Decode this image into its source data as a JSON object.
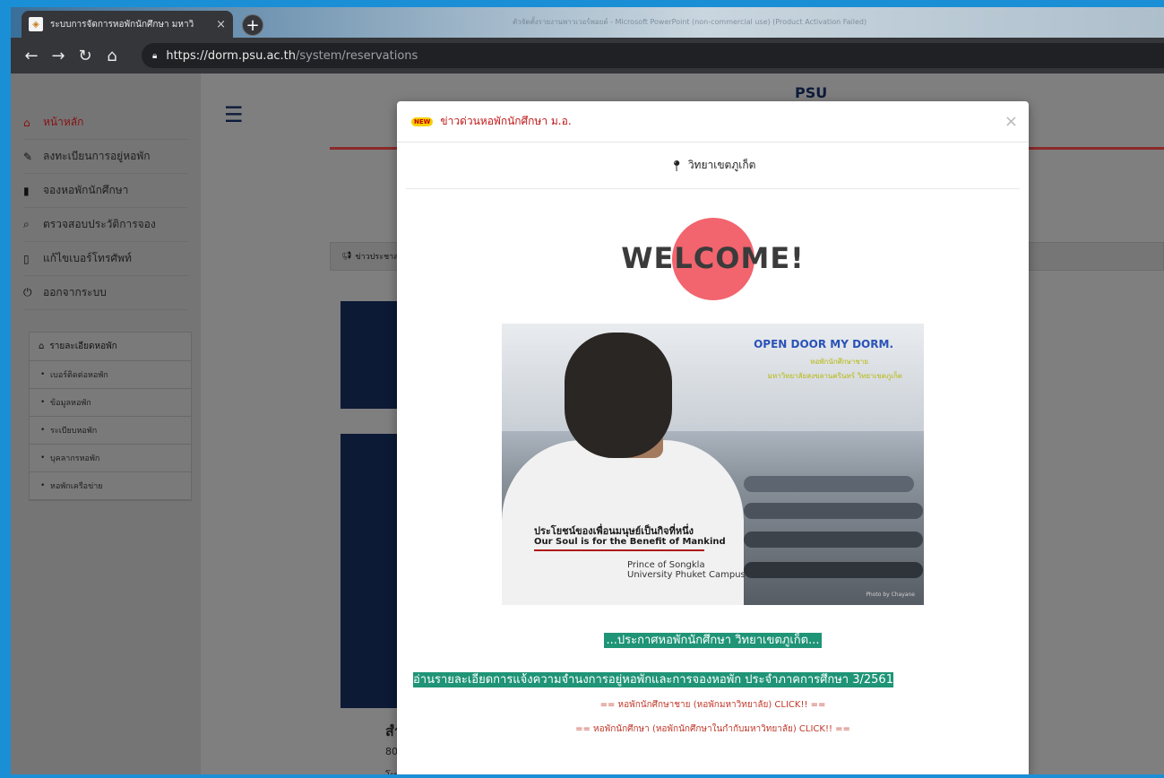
{
  "browser": {
    "tab_title": "ระบบการจัดการหอพักนักศึกษา มหาวิ",
    "tab_close": "×",
    "new_tab": "+",
    "window_title_blurred": "ตัวจัดตั้งรายงานพาวเวอร์พอยต์ - Microsoft PowerPoint (non-commercial use) (Product Activation Failed)",
    "url_host": "https://dorm.psu.ac.th",
    "url_path": "/system/reservations",
    "nav_icons": [
      "back-arrow-icon",
      "forward-arrow-icon",
      "reload-icon",
      "home-icon"
    ]
  },
  "sidebar": {
    "items": [
      {
        "label": "หน้าหลัก",
        "icon": "home-icon",
        "glyph": "🏠︎",
        "active": true
      },
      {
        "label": "ลงทะเบียนการอยู่หอพัก",
        "icon": "pencil-icon",
        "glyph": "✎",
        "active": false
      },
      {
        "label": "จองหอพักนักศึกษา",
        "icon": "book-icon",
        "glyph": "▮",
        "active": false
      },
      {
        "label": "ตรวจสอบประวัติการจอง",
        "icon": "search-icon",
        "glyph": "⌕",
        "active": false
      },
      {
        "label": "แก้ไขเบอร์โทรศัพท์",
        "icon": "phone-icon",
        "glyph": "▯",
        "active": false
      },
      {
        "label": "ออกจากระบบ",
        "icon": "power-icon",
        "glyph": "⏻",
        "active": false
      }
    ],
    "panel_title": "รายละเอียดหอพัก",
    "panel_items": [
      "เบอร์ติดต่อหอพัก",
      "ข้อมูลหอพัก",
      "ระเบียบหอพัก",
      "บุคลากรหอพัก",
      "หอพักเครือข่าย"
    ]
  },
  "background_page": {
    "logo": "PSU",
    "news_header": "ข่าวประชาส",
    "heading_partial": "สำ",
    "text_line1": "80",
    "text_line2": "โท"
  },
  "modal": {
    "badge": "NEW",
    "title": "ข่าวด่วนหอพักนักศึกษา ม.อ.",
    "close": "×",
    "campus": "วิทยาเขตภูเก็ต",
    "welcome": "WELCOME!",
    "photo": {
      "headline": "OPEN DOOR MY DORM.",
      "sub1": "หอพักนักศึกษาชาย",
      "sub2": "มหาวิทยาลัยสงขลานครินทร์ วิทยาเขตภูเก็ต",
      "slogan_th": "ประโยชน์ของเพื่อนมนุษย์เป็นกิจที่หนึ่ง",
      "slogan_en": "Our Soul is for the Benefit of Mankind",
      "campus_label": "Prince of Songkla University Phuket Campus",
      "credit": "Photo by Chayane"
    },
    "announcement": "...ประกาศหอพักนักศึกษา วิทยาเขตภูเก็ต...",
    "details": "อ่านรายละเอียดการแจ้งความจำนงการอยู่หอพักและการจองหอพัก ประจำภาคการศึกษา 3/2561",
    "link_male": "== หอพักนักศึกษาชาย (หอพักมหาวิทยาลัย) CLICK!! ==",
    "link_all": "== หอพักนักศึกษา (หอพักนักศึกษาในกำกับมหาวิทยาลัย) CLICK!! =="
  },
  "colors": {
    "accent_green": "#1f9477",
    "link_red": "#c0392b",
    "title_red": "#c01818",
    "welcome_circle": "#f2646e"
  }
}
